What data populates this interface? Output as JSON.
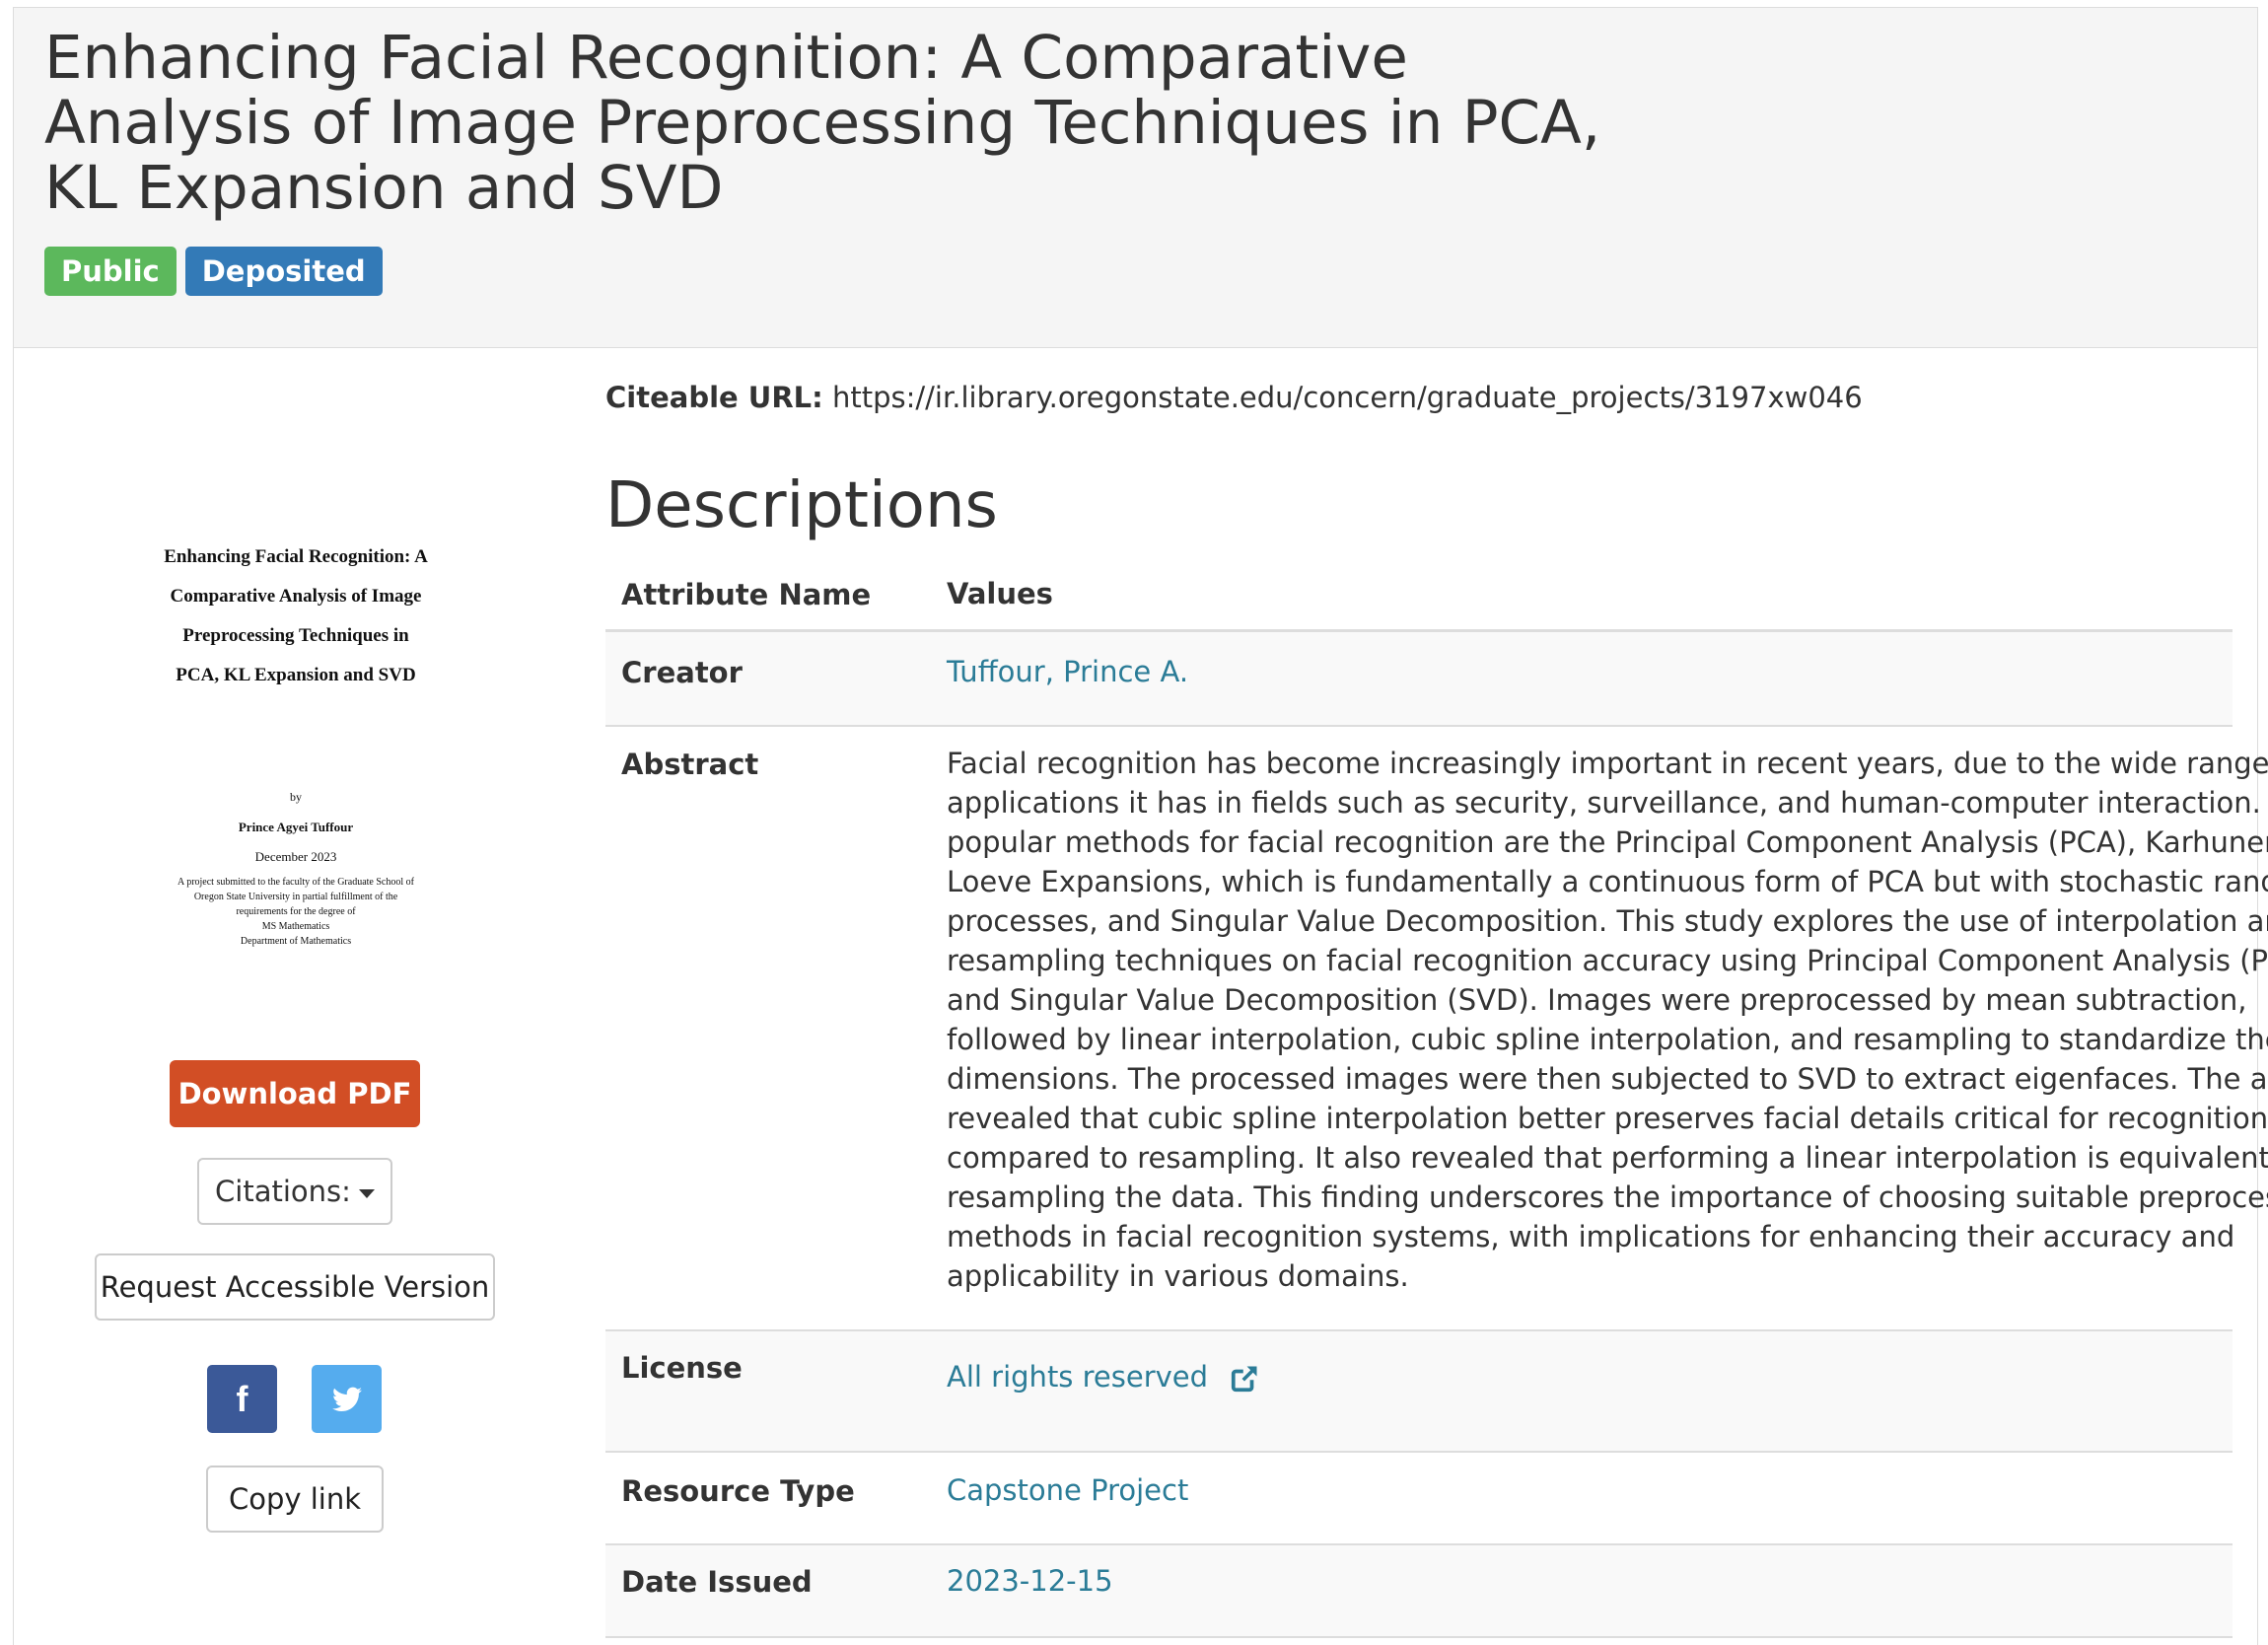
{
  "header": {
    "title_lines": [
      "Enhancing Facial Recognition: A Comparative",
      "Analysis of Image Preprocessing Techniques in PCA,",
      "KL Expansion and SVD"
    ],
    "badges": {
      "public": "Public",
      "deposited": "Deposited"
    },
    "colors": {
      "public": "#5cb85c",
      "deposited": "#337ab7"
    }
  },
  "thumbnail": {
    "title_lines": [
      "Enhancing Facial Recognition: A",
      "Comparative Analysis of Image",
      "Preprocessing Techniques in",
      "PCA, KL Expansion and SVD"
    ],
    "by": "by",
    "author": "Prince Agyei Tuffour",
    "date": "December 2023",
    "notes": [
      "A project submitted to the faculty of the Graduate School of",
      "Oregon State University in partial fulfillment of the",
      "requirements for the degree of",
      "MS Mathematics",
      "Department of Mathematics"
    ]
  },
  "sidebar": {
    "download_label": "Download PDF",
    "download_color": "#d24e25",
    "citations_label": "Citations:",
    "accessible_label": "Request Accessible Version",
    "facebook_icon": "facebook-icon",
    "facebook_glyph": "f",
    "twitter_icon": "twitter-icon",
    "copy_label": "Copy link"
  },
  "main": {
    "citeable_label": "Citeable URL:",
    "citeable_url": "https://ir.library.oregonstate.edu/concern/graduate_projects/3197xw046",
    "descriptions_heading": "Descriptions",
    "table": {
      "col_name": "Attribute Name",
      "col_values": "Values",
      "creator_label": "Creator",
      "creator_value": "Tuffour, Prince A.",
      "abstract_label": "Abstract",
      "abstract_lines": [
        "Facial recognition has become increasingly important in recent years, due to the wide range of",
        "applications it has in fields such as security, surveillance, and human-computer interaction. Three",
        "popular methods for facial recognition are the Principal Component Analysis (PCA), Karhunen-",
        "Loeve Expansions, which is fundamentally a continuous form of PCA but with stochastic random",
        "processes, and Singular Value Decomposition. This study explores the use of interpolation and",
        "resampling techniques on facial recognition accuracy using Principal Component Analysis (PCA)",
        "and Singular Value Decomposition (SVD). Images were preprocessed by mean subtraction,",
        "followed by linear interpolation, cubic spline interpolation, and resampling to standardize their",
        "dimensions. The processed images were then subjected to SVD to extract eigenfaces. The analysis",
        "revealed that cubic spline interpolation better preserves facial details critical for recognition",
        "compared to resampling. It also revealed that performing a linear interpolation is equivalent to",
        "resampling the data. This finding underscores the importance of choosing suitable preprocessing",
        "methods in facial recognition systems, with implications for enhancing their accuracy and",
        "applicability in various domains."
      ],
      "license_label": "License",
      "license_value": "All rights reserved",
      "license_icon": "external-link-icon",
      "resource_label": "Resource Type",
      "resource_value": "Capstone Project",
      "date_label": "Date Issued",
      "date_value": "2023-12-15"
    },
    "link_color": "#2b7c97"
  }
}
